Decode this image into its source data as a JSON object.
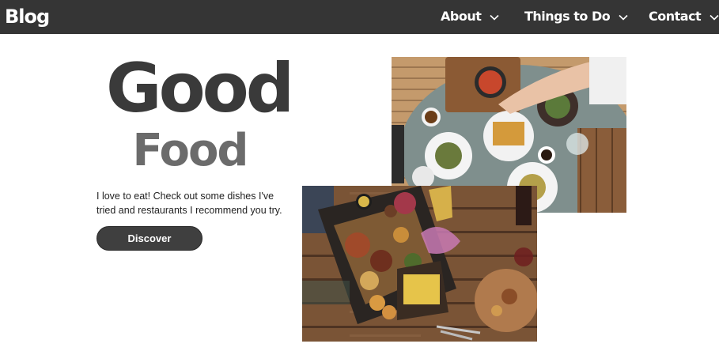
{
  "navbar": {
    "brand": "Blog",
    "items": [
      {
        "label": "About"
      },
      {
        "label": "Things to Do"
      },
      {
        "label": "Contact"
      }
    ]
  },
  "hero": {
    "title": "Good",
    "subtitle": "Food",
    "description": "I love to eat! Check out some dishes I've tried and restaurants I recommend you try.",
    "button_label": "Discover"
  },
  "colors": {
    "navbar_bg": "#353535",
    "title": "#3a3a3a",
    "subtitle": "#6b6b6b",
    "button_bg": "#3f3f3f"
  },
  "icons": [
    "chevron-down-icon"
  ]
}
